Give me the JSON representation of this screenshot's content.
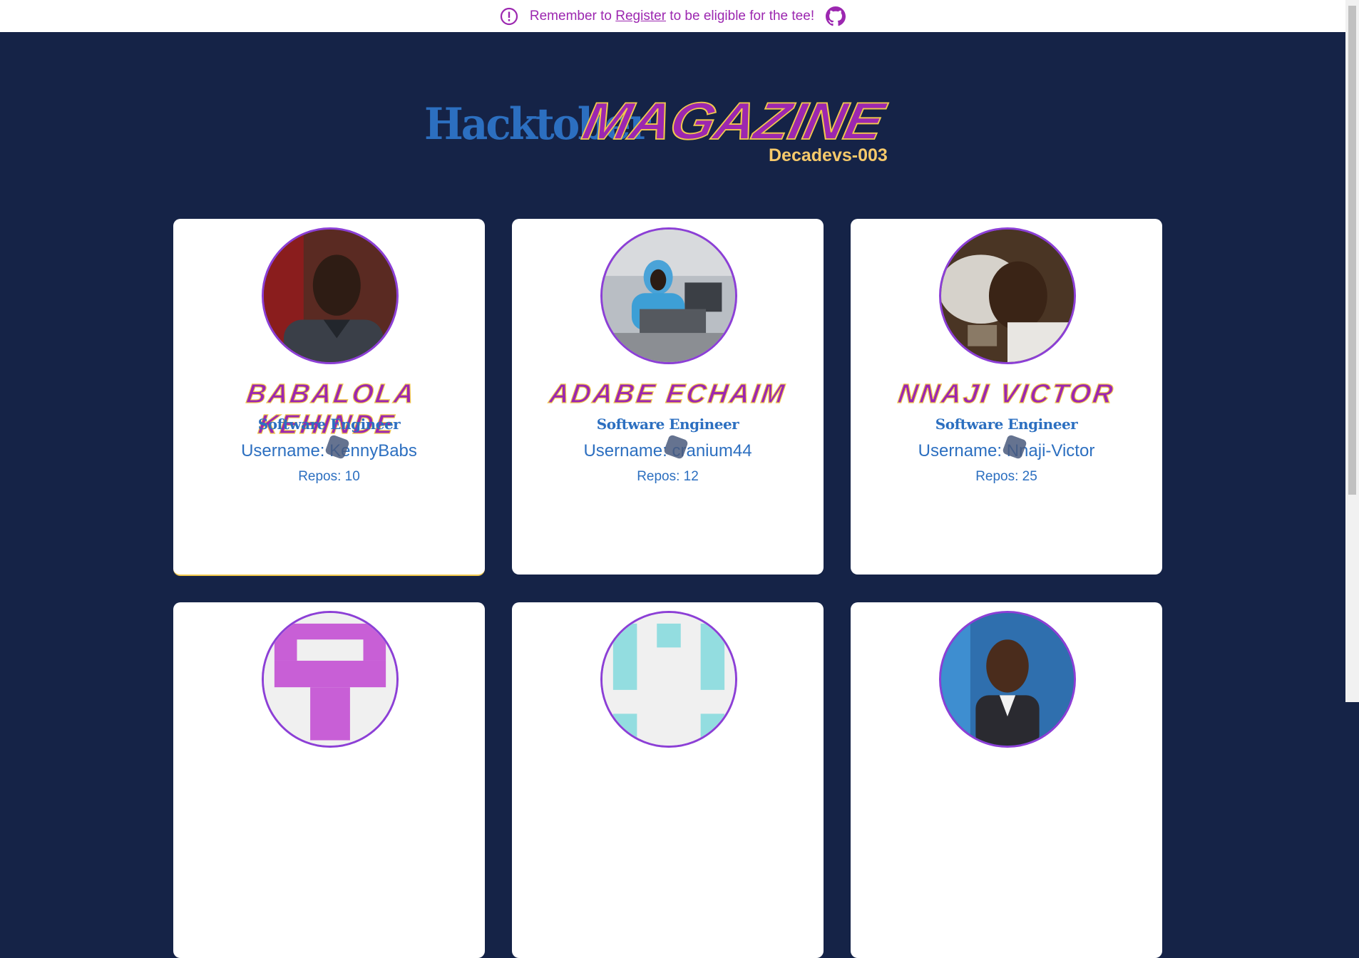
{
  "banner": {
    "text_before": "Remember to ",
    "link": "Register",
    "text_after": " to be eligible for the tee!",
    "icons": [
      "alert-circle-icon",
      "github-icon"
    ]
  },
  "logo": {
    "hack": "Hacktober",
    "magazine": "MAGAZINE",
    "subtitle": "Decadevs-003"
  },
  "colors": {
    "background": "#152347",
    "accent_purple": "#9c27b0",
    "accent_blue": "#2c6fc0",
    "accent_yellow": "#f2c94c"
  },
  "profiles": [
    {
      "name": "BABALOLA KEHINDE",
      "role": "Software Engineer",
      "username": "Username: KennyBabs",
      "repos": "Repos: 10"
    },
    {
      "name": "ADABE ECHAIM",
      "role": "Software Engineer",
      "username": "Username: cranium44",
      "repos": "Repos: 12"
    },
    {
      "name": "NNAJI VICTOR",
      "role": "Software Engineer",
      "username": "Username: Nnaji-Victor",
      "repos": "Repos: 25"
    },
    {
      "name": "",
      "role": "",
      "username": "",
      "repos": ""
    },
    {
      "name": "",
      "role": "",
      "username": "",
      "repos": ""
    },
    {
      "name": "",
      "role": "",
      "username": "",
      "repos": ""
    }
  ]
}
